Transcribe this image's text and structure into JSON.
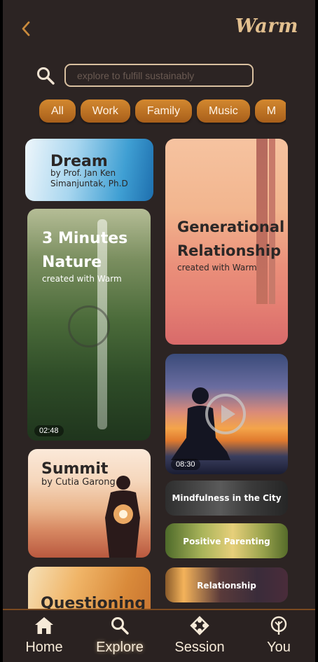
{
  "header": {
    "brand": "Warm"
  },
  "search": {
    "placeholder": "explore to fulfill sustainably"
  },
  "chips": [
    "All",
    "Work",
    "Family",
    "Music",
    "M"
  ],
  "cards": {
    "dream": {
      "title": "Dream",
      "subtitle_line1": "by Prof. Jan Ken",
      "subtitle_line2": "Simanjuntak, Ph.D"
    },
    "nature": {
      "title_line1": "3 Minutes",
      "title_line2": "Nature",
      "subtitle": "created with Warm",
      "duration": "02:48"
    },
    "generational": {
      "title_line1": "Generational",
      "title_line2": "Relationship",
      "subtitle": "created with Warm"
    },
    "meditation": {
      "duration": "08:30"
    },
    "summit": {
      "title": "Summit",
      "subtitle": "by Cutia Garong"
    },
    "mindfulness": {
      "title": "Mindfulness in the City"
    },
    "parenting": {
      "title": "Positive Parenting"
    },
    "questioning": {
      "title": "Questioning"
    },
    "relationship": {
      "title": "Relationship"
    }
  },
  "nav": [
    {
      "label": "Home",
      "icon": "home-icon"
    },
    {
      "label": "Explore",
      "icon": "search-icon",
      "active": true
    },
    {
      "label": "Session",
      "icon": "session-icon"
    },
    {
      "label": "You",
      "icon": "tree-icon"
    }
  ],
  "colors": {
    "background": "#2c2423",
    "accent": "#c27a2b",
    "brand": "#e3c08f"
  }
}
